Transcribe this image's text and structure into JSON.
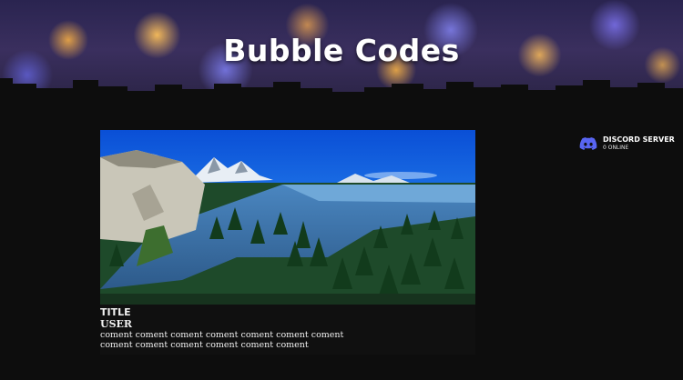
{
  "header": {
    "title": "Bubble Codes"
  },
  "discord": {
    "label": "DISCORD SERVER",
    "status": "0 ONLINE",
    "icon": "discord-icon",
    "accent": "#5865f2"
  },
  "post": {
    "thumbnail": "game-thumbnail",
    "title": "TITLE",
    "user": "USER",
    "comment": "coment coment coment coment coment coment coment coment coment coment coment coment coment"
  }
}
